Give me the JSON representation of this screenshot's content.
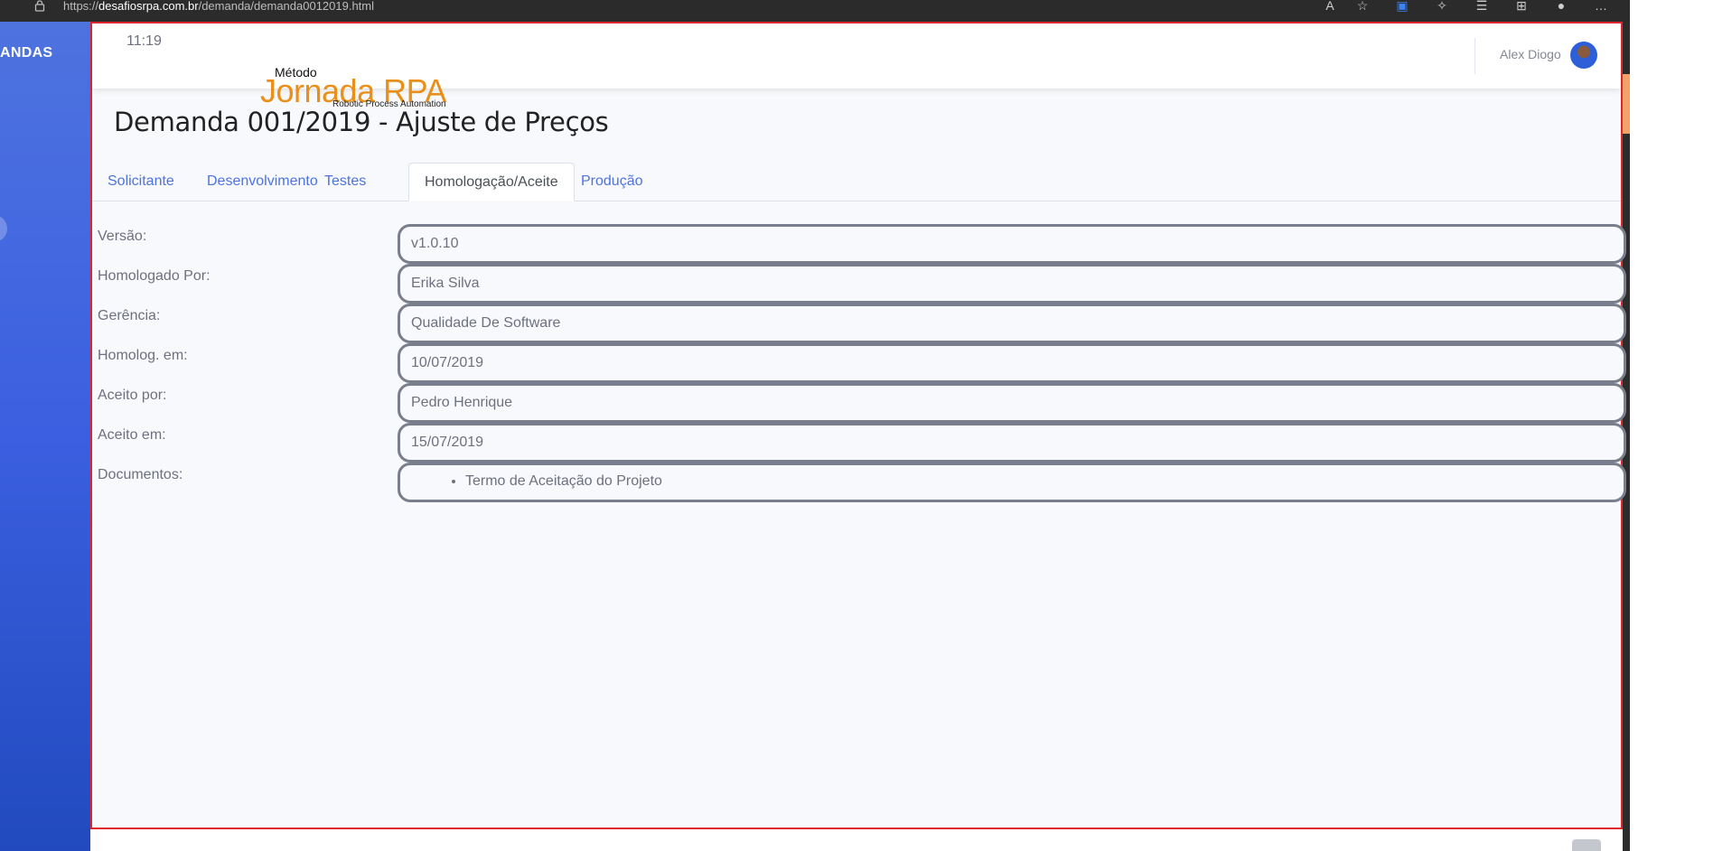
{
  "browser": {
    "url_scheme": "https://",
    "url_host": "desafiosrpa.com.br",
    "url_path": "/demanda/demanda0012019.html",
    "icons": [
      "read-aloud-icon",
      "favorite-icon",
      "extension-icon",
      "puzzle-icon",
      "favorites-bar-icon",
      "collections-icon",
      "profile-icon",
      "more-icon"
    ]
  },
  "sidebar": {
    "brand": "ANDAS"
  },
  "topbar": {
    "time": "11:19",
    "logo": {
      "metodo": "Método",
      "jornada": "Jornada RPA",
      "subtitle": "Robotic Process Automation"
    },
    "user_name": "Alex Diogo"
  },
  "page": {
    "title": "Demanda 001/2019 - Ajuste de Preços"
  },
  "tabs": [
    {
      "label": "Solicitante",
      "active": false
    },
    {
      "label": "Desenvolvimento",
      "active": false
    },
    {
      "label": "Testes",
      "active": false
    },
    {
      "label": "Homologação/Aceite",
      "active": true
    },
    {
      "label": "Produção",
      "active": false
    }
  ],
  "form": {
    "rows": [
      {
        "label": "Versão:",
        "value": "v1.0.10"
      },
      {
        "label": "Homologado Por:",
        "value": "Erika Silva"
      },
      {
        "label": "Gerência:",
        "value": "Qualidade De Software"
      },
      {
        "label": "Homolog. em:",
        "value": "10/07/2019"
      },
      {
        "label": "Aceito por:",
        "value": "Pedro Henrique"
      },
      {
        "label": "Aceito em:",
        "value": "15/07/2019"
      }
    ],
    "documents": {
      "label": "Documentos:",
      "items": [
        "Termo de Aceitação do Projeto"
      ]
    }
  },
  "colors": {
    "sidebar_top": "#4e73df",
    "sidebar_bottom": "#224abe",
    "tab_link": "#4e73df",
    "logo_orange": "#e8901a",
    "frame_outline": "#e0262c"
  }
}
